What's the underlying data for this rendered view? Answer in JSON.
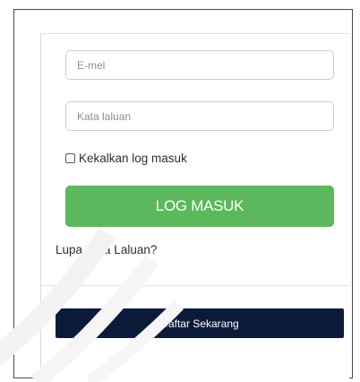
{
  "login_form": {
    "email": {
      "placeholder": "E-mel",
      "value": ""
    },
    "password": {
      "placeholder": "Kata laluan",
      "value": ""
    },
    "remember_me": {
      "label": "Kekalkan log masuk",
      "checked": false
    },
    "login_button_label": "LOG MASUK",
    "forgot_password_label": "Lupa Kata Laluan?",
    "register_button_label": "Daftar Sekarang"
  },
  "colors": {
    "login_button": "#5cb85c",
    "register_button": "#0c1a3a",
    "field_border": "#cfcfcf"
  }
}
